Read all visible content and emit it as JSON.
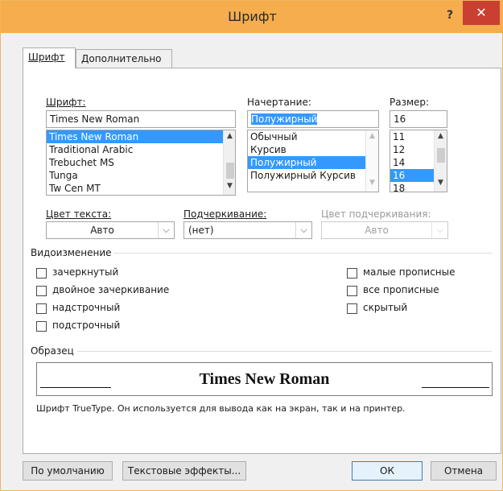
{
  "window": {
    "title": "Шрифт"
  },
  "titlebar": {
    "help_label": "?",
    "close_label": "✕",
    "help_icon": "question-icon",
    "close_icon": "close-icon"
  },
  "tabs": [
    {
      "label": "Шрифт",
      "selected": true
    },
    {
      "label": "Дополнительно",
      "selected": false
    }
  ],
  "font": {
    "label": "Шрифт:",
    "value": "Times New Roman",
    "options": [
      "Times New Roman",
      "Traditional Arabic",
      "Trebuchet MS",
      "Tunga",
      "Tw Cen MT"
    ],
    "selected": "Times New Roman"
  },
  "style": {
    "label": "Начертание:",
    "value": "Полужирный",
    "options": [
      "Обычный",
      "Курсив",
      "Полужирный",
      "Полужирный Курсив"
    ],
    "selected": "Полужирный"
  },
  "size": {
    "label": "Размер:",
    "value": "16",
    "options": [
      "11",
      "12",
      "14",
      "16",
      "18"
    ],
    "selected": "16"
  },
  "font_color": {
    "label": "Цвет текста:",
    "value": "Авто"
  },
  "underline": {
    "label": "Подчеркивание:",
    "value": "(нет)"
  },
  "underline_color": {
    "label": "Цвет подчеркивания:",
    "value": "Авто"
  },
  "effects": {
    "title": "Видоизменение",
    "left": [
      {
        "label": "зачеркнутый",
        "checked": false
      },
      {
        "label": "двойное зачеркивание",
        "checked": false
      },
      {
        "label": "надстрочный",
        "checked": false
      },
      {
        "label": "подстрочный",
        "checked": false
      }
    ],
    "right": [
      {
        "label": "малые прописные",
        "checked": false
      },
      {
        "label": "все прописные",
        "checked": false
      },
      {
        "label": "скрытый",
        "checked": false
      }
    ]
  },
  "preview": {
    "title": "Образец",
    "text": "Times New Roman",
    "note": "Шрифт TrueType. Он используется для вывода как на экран, так и на принтер."
  },
  "buttons": {
    "default": "По умолчанию",
    "text_effects": "Текстовые эффекты...",
    "ok": "ОК",
    "cancel": "Отмена"
  },
  "colors": {
    "titlebar": "#f5ad4d",
    "selection": "#3399ff",
    "close": "#c94032"
  }
}
